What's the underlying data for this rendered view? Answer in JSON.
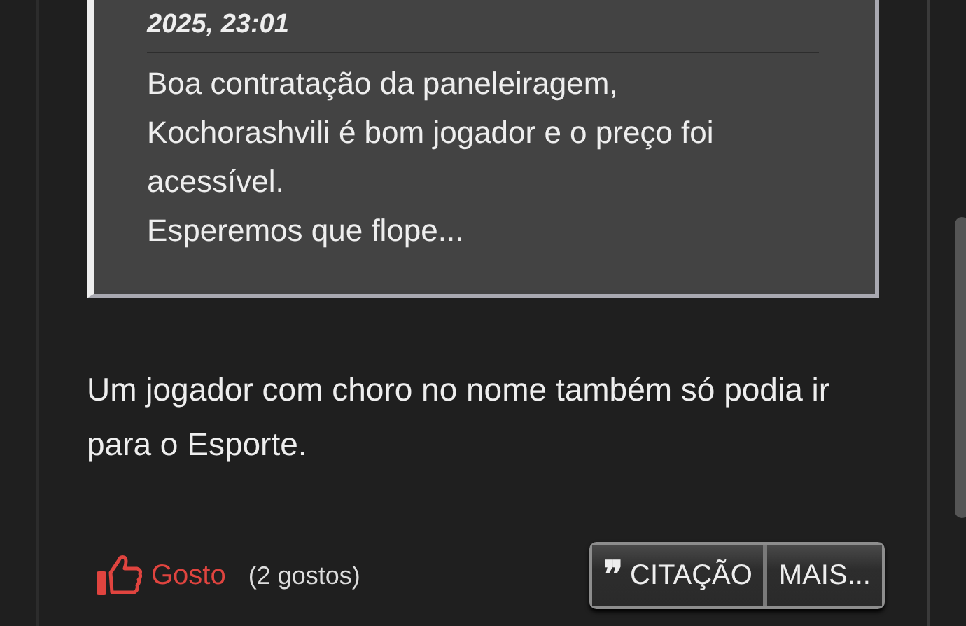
{
  "quote": {
    "header": "2025, 23:01",
    "lines": [
      "Boa contratação da paneleiragem,",
      "Kochorashvili é bom jogador e o preço foi acessível.",
      "Esperemos que flope..."
    ]
  },
  "post_text": "Um jogador com choro no nome também só podia ir para o Esporte.",
  "like": {
    "label": "Gosto",
    "liked": true,
    "count": "(2 gostos)"
  },
  "buttons": [
    {
      "kind": "quote",
      "icon": "❞",
      "label": "CITAÇÃO"
    },
    {
      "kind": "more",
      "label": "MAIS..."
    }
  ]
}
